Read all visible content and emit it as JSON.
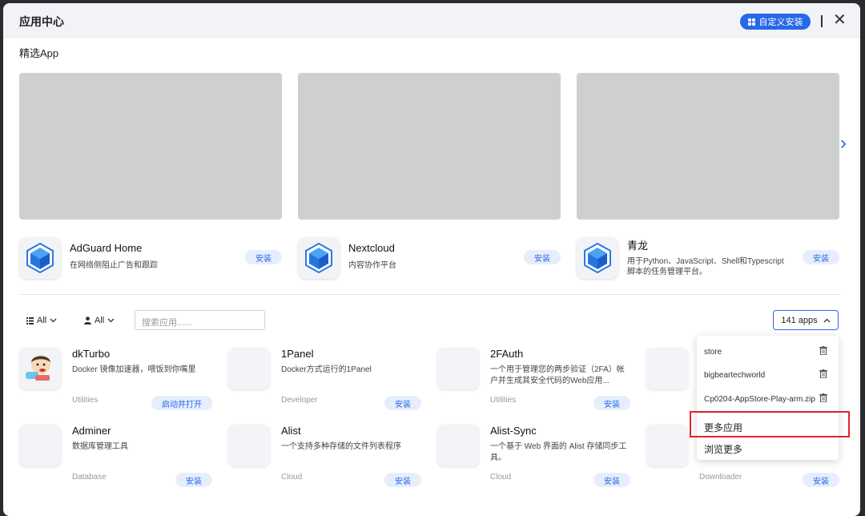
{
  "window": {
    "title": "应用中心",
    "custom_install_label": "自定义安装",
    "close_label": "✕"
  },
  "featured": {
    "section_title": "精选App",
    "next_arrow": "›",
    "items": [
      {
        "name": "AdGuard Home",
        "desc": "在网络侧阻止广告和跟踪",
        "button": "安装"
      },
      {
        "name": "Nextcloud",
        "desc": "内容协作平台",
        "button": "安装"
      },
      {
        "name": "青龙",
        "desc": "用于Python、JavaScript、Shell和Typescript脚本的任务管理平台。",
        "button": "安装"
      }
    ]
  },
  "filters": {
    "category": "All",
    "user": "All",
    "search_placeholder": "搜索应用......",
    "count_label": "141 apps"
  },
  "apps": [
    {
      "name": "dkTurbo",
      "desc": "Docker 镜像加速器，喂饭到你嘴里",
      "category": "Utilities",
      "button": "启动并打开"
    },
    {
      "name": "1Panel",
      "desc": "Docker方式运行的1Panel",
      "category": "Developer",
      "button": "安装"
    },
    {
      "name": "2FAuth",
      "desc": "一个用于管理您的两步验证（2FA）帐户并生成其安全代码的Web应用...",
      "category": "Utilities",
      "button": "安装"
    },
    {
      "name": "Adminer",
      "desc": "数据库管理工具",
      "category": "Database",
      "button": "安装"
    },
    {
      "name": "Alist",
      "desc": "一个支持多种存储的文件列表程序",
      "category": "Cloud",
      "button": "安装"
    },
    {
      "name": "Alist-Sync",
      "desc": "一个基于 Web 界面的 Alist 存储同步工具。",
      "category": "Cloud",
      "button": "安装"
    },
    {
      "name": "",
      "desc": "",
      "category": "Downloader",
      "button": "安装"
    }
  ],
  "dropdown": {
    "sources": [
      "store",
      "bigbeartechworld",
      "Cp0204-AppStore-Play-arm.zip"
    ],
    "more_apps": "更多应用",
    "browse_more": "浏览更多"
  },
  "colors": {
    "accent": "#2768e8",
    "highlight_border": "#e0252b",
    "banner_placeholder": "#cfcfcf"
  }
}
